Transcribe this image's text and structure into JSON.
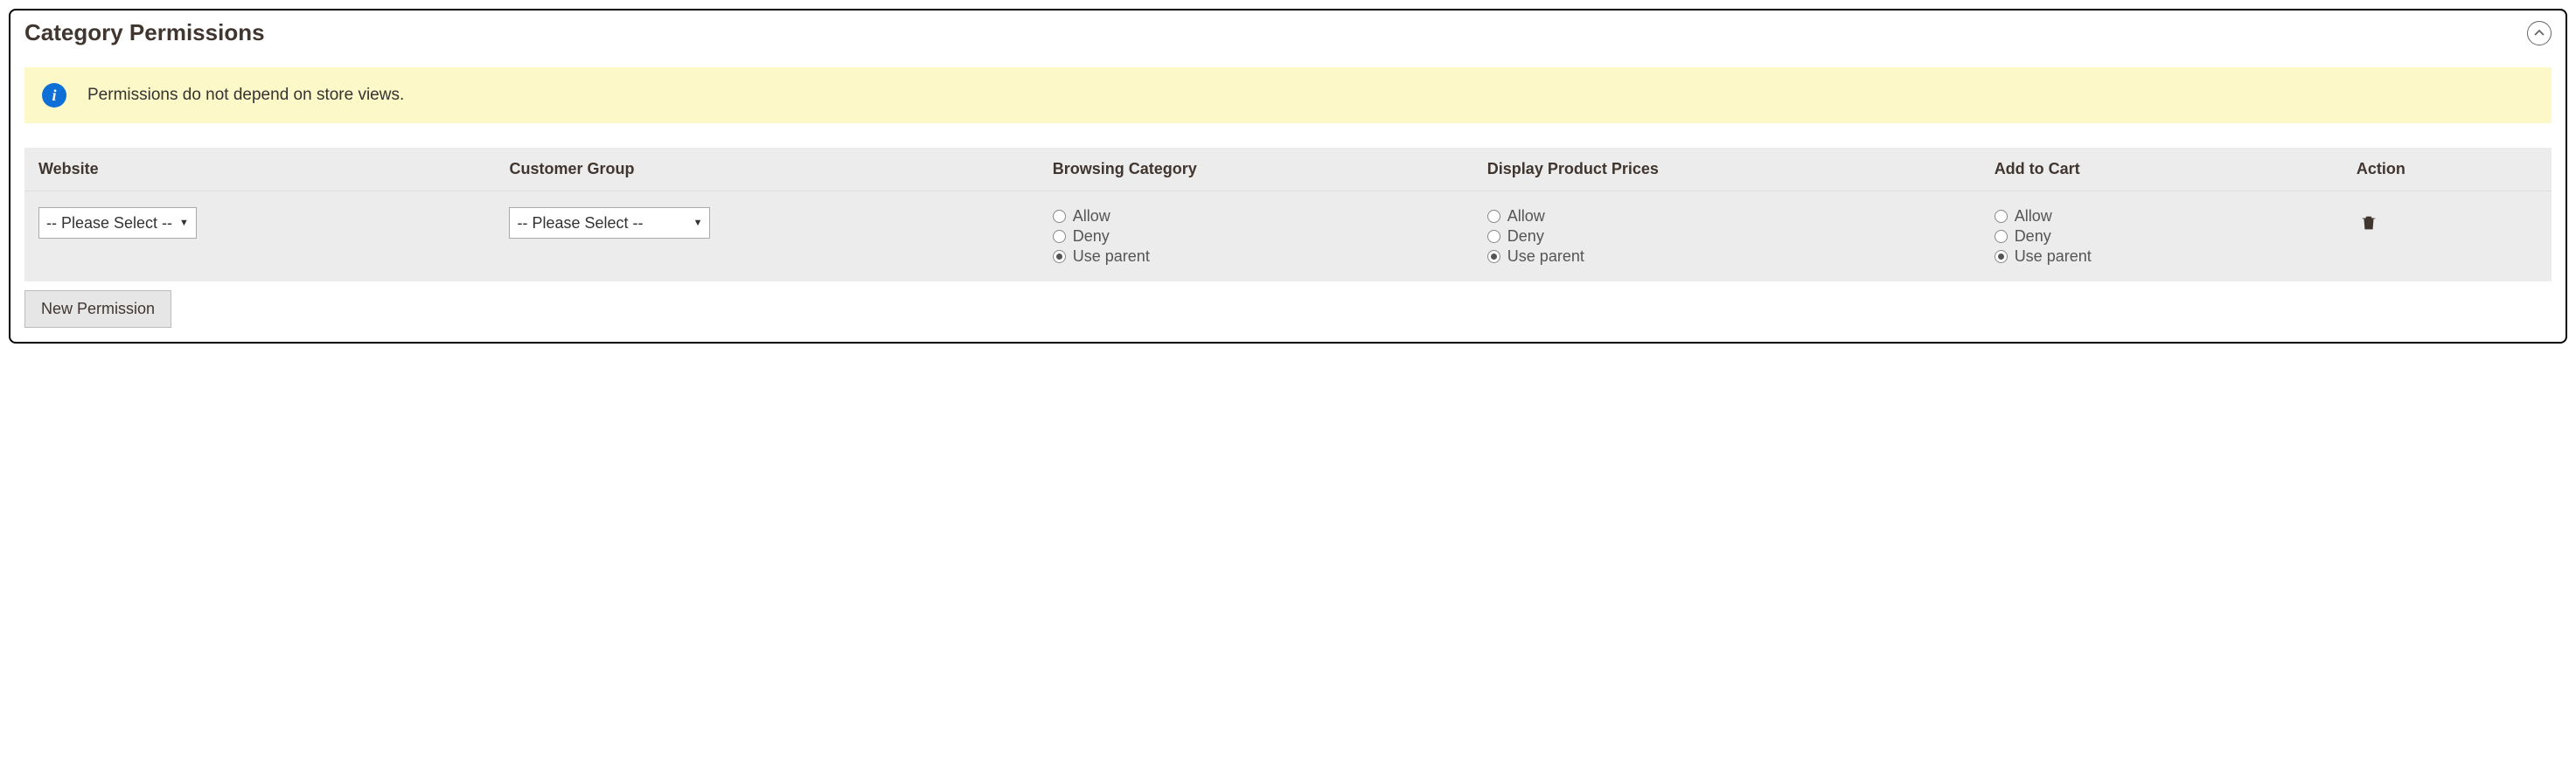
{
  "panel": {
    "title": "Category Permissions"
  },
  "banner": {
    "text": "Permissions do not depend on store views."
  },
  "headers": {
    "website": "Website",
    "customer_group": "Customer Group",
    "browsing": "Browsing Category",
    "prices": "Display Product Prices",
    "cart": "Add to Cart",
    "action": "Action"
  },
  "row": {
    "website_select": "-- Please Select --",
    "group_select": "-- Please Select --",
    "radio": {
      "allow": "Allow",
      "deny": "Deny",
      "use_parent": "Use parent"
    }
  },
  "buttons": {
    "new_permission": "New Permission"
  }
}
